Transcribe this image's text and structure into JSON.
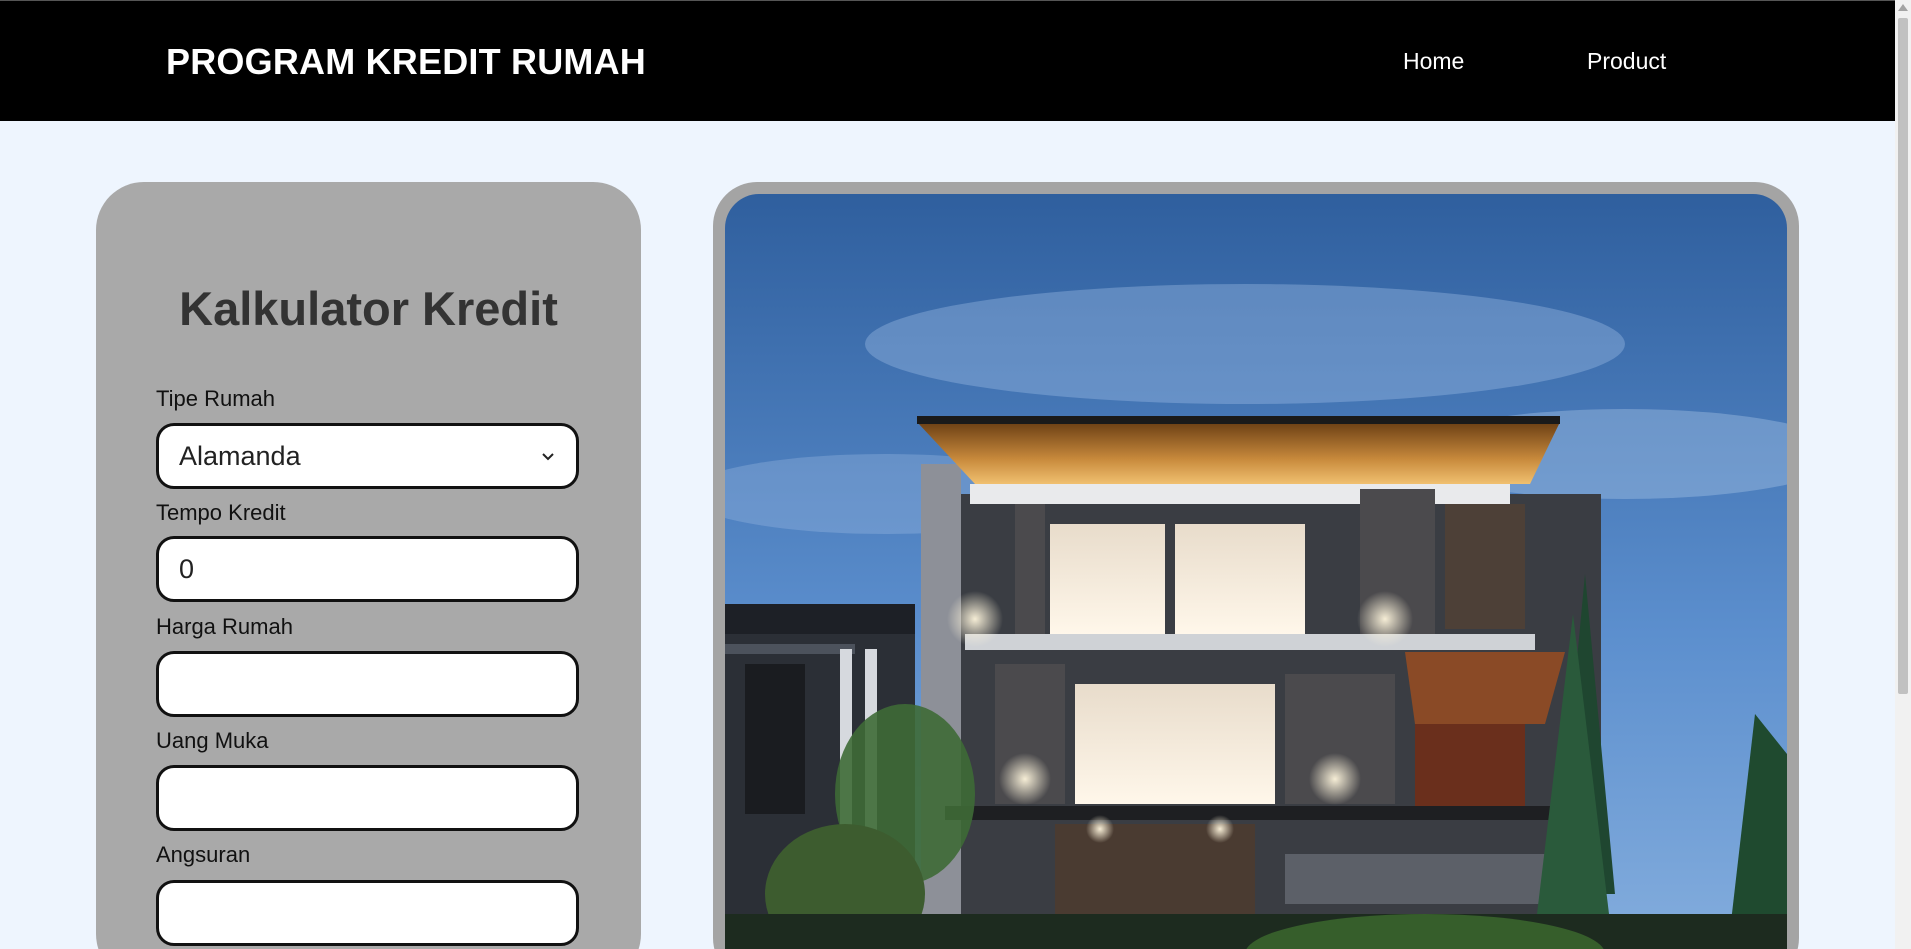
{
  "header": {
    "brand": "PROGRAM KREDIT RUMAH",
    "nav": [
      {
        "label": "Home"
      },
      {
        "label": "Product"
      }
    ]
  },
  "calculator": {
    "title": "Kalkulator Kredit",
    "fields": {
      "tipe_rumah": {
        "label": "Tipe Rumah",
        "value": "Alamanda"
      },
      "tempo_kredit": {
        "label": "Tempo Kredit",
        "value": "0"
      },
      "harga_rumah": {
        "label": "Harga Rumah",
        "value": ""
      },
      "uang_muka": {
        "label": "Uang Muka",
        "value": ""
      },
      "angsuran": {
        "label": "Angsuran",
        "value": ""
      }
    }
  },
  "colors": {
    "header_bg": "#000000",
    "page_bg": "#eef5fe",
    "card_bg": "#a9a9a9"
  }
}
